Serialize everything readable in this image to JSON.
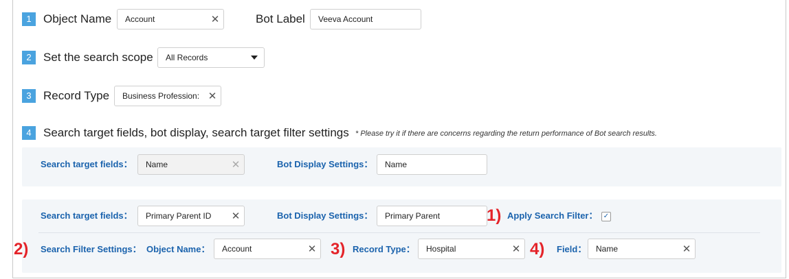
{
  "steps": {
    "s1": "1",
    "s2": "2",
    "s3": "3",
    "s4": "4"
  },
  "object_name": {
    "label": "Object Name",
    "value": "Account"
  },
  "bot_label": {
    "label": "Bot Label",
    "value": "Veeva Account"
  },
  "search_scope": {
    "label": "Set the search scope",
    "value": "All Records"
  },
  "record_type": {
    "label": "Record Type",
    "value": "Business Profession:"
  },
  "section4": {
    "title": "Search target fields, bot display, search target filter settings",
    "note": "* Please try it if there are concerns regarding the return performance of Bot search results."
  },
  "row1": {
    "search_target_label": "Search target fields：",
    "search_target_value": "Name",
    "bot_display_label": "Bot Display Settings：",
    "bot_display_value": "Name"
  },
  "row2": {
    "search_target_label": "Search target fields：",
    "search_target_value": "Primary Parent ID",
    "bot_display_label": "Bot Display Settings：",
    "bot_display_value": "Primary Parent",
    "apply_filter_label": "Apply Search Filter：",
    "apply_filter_checked": "✓"
  },
  "filter": {
    "settings_label": "Search Filter Settings：",
    "object_name_label": "Object Name：",
    "object_name_value": "Account",
    "record_type_label": "Record Type：",
    "record_type_value": "Hospital",
    "field_label": "Field：",
    "field_value": "Name"
  },
  "annotations": {
    "a1": "1)",
    "a2": "2)",
    "a3": "3)",
    "a4": "4)"
  },
  "icons": {
    "clear": "✕"
  },
  "colors": {
    "step_badge": "#4aa3df",
    "label_blue": "#1b63ad",
    "annotation_red": "#e4242a",
    "panel_bg": "#f3f6f9"
  }
}
